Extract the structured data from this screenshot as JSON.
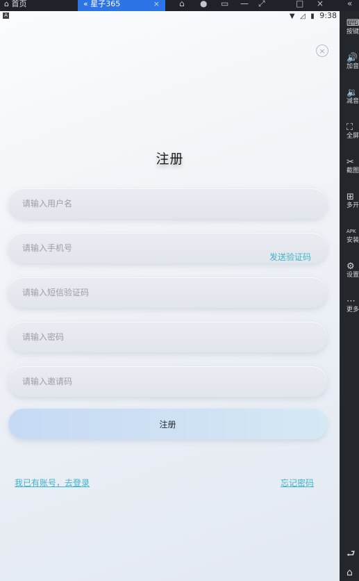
{
  "host_window": {
    "home_tab": "首页",
    "active_tab": "星子365",
    "tab_close": "×",
    "controls": [
      "⌂",
      "●",
      "▭",
      "—",
      "⤢",
      "□",
      "×",
      "«"
    ]
  },
  "host_sidebar": {
    "items": [
      {
        "icon": "⌨",
        "label": "按键"
      },
      {
        "icon": "🔊",
        "label": "加音"
      },
      {
        "icon": "🔉",
        "label": "减音"
      },
      {
        "icon": "⛶",
        "label": "全屏"
      },
      {
        "icon": "✂",
        "label": "截图"
      },
      {
        "icon": "⊞",
        "label": "多开"
      },
      {
        "icon": "APK",
        "label": "安装"
      },
      {
        "icon": "⚙",
        "label": "设置"
      },
      {
        "icon": "⋯",
        "label": "更多"
      }
    ],
    "back_icon": "⮐",
    "home_icon": "⌂"
  },
  "status_bar": {
    "badge": "A",
    "time": "9:38"
  },
  "register_form": {
    "title": "注册",
    "close_symbol": "×",
    "username_placeholder": "请输入用户名",
    "phone_placeholder": "请输入手机号",
    "send_code_label": "发送验证码",
    "sms_code_placeholder": "请输入短信验证码",
    "password_placeholder": "请输入密码",
    "invite_code_placeholder": "请输入邀请码",
    "submit_label": "注册",
    "login_link": "我已有账号，去登录",
    "forgot_link": "忘记密码"
  },
  "colors": {
    "accent_link": "#3fb3c9",
    "host_active_tab": "#2d74e6",
    "submit_gradient_start": "#c6daf4",
    "submit_gradient_end": "#d5e9f4"
  }
}
